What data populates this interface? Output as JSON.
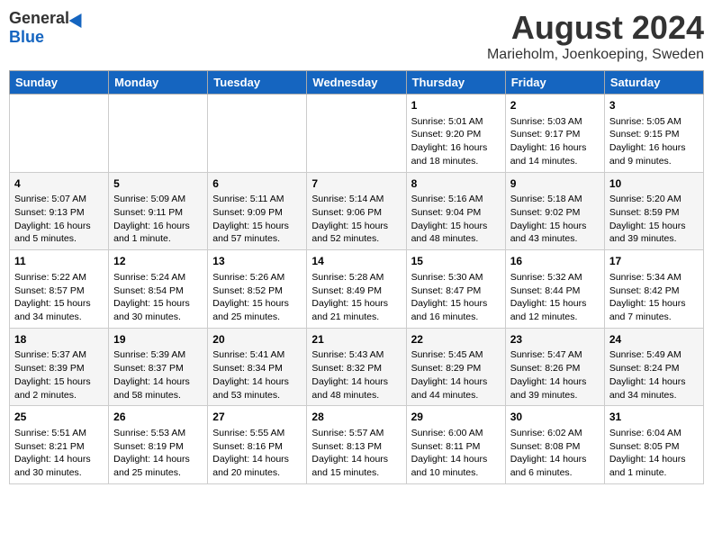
{
  "header": {
    "logo_general": "General",
    "logo_blue": "Blue",
    "month_year": "August 2024",
    "location": "Marieholm, Joenkoeping, Sweden"
  },
  "days_of_week": [
    "Sunday",
    "Monday",
    "Tuesday",
    "Wednesday",
    "Thursday",
    "Friday",
    "Saturday"
  ],
  "weeks": [
    [
      {
        "day": "",
        "info": ""
      },
      {
        "day": "",
        "info": ""
      },
      {
        "day": "",
        "info": ""
      },
      {
        "day": "",
        "info": ""
      },
      {
        "day": "1",
        "info": "Sunrise: 5:01 AM\nSunset: 9:20 PM\nDaylight: 16 hours\nand 18 minutes."
      },
      {
        "day": "2",
        "info": "Sunrise: 5:03 AM\nSunset: 9:17 PM\nDaylight: 16 hours\nand 14 minutes."
      },
      {
        "day": "3",
        "info": "Sunrise: 5:05 AM\nSunset: 9:15 PM\nDaylight: 16 hours\nand 9 minutes."
      }
    ],
    [
      {
        "day": "4",
        "info": "Sunrise: 5:07 AM\nSunset: 9:13 PM\nDaylight: 16 hours\nand 5 minutes."
      },
      {
        "day": "5",
        "info": "Sunrise: 5:09 AM\nSunset: 9:11 PM\nDaylight: 16 hours\nand 1 minute."
      },
      {
        "day": "6",
        "info": "Sunrise: 5:11 AM\nSunset: 9:09 PM\nDaylight: 15 hours\nand 57 minutes."
      },
      {
        "day": "7",
        "info": "Sunrise: 5:14 AM\nSunset: 9:06 PM\nDaylight: 15 hours\nand 52 minutes."
      },
      {
        "day": "8",
        "info": "Sunrise: 5:16 AM\nSunset: 9:04 PM\nDaylight: 15 hours\nand 48 minutes."
      },
      {
        "day": "9",
        "info": "Sunrise: 5:18 AM\nSunset: 9:02 PM\nDaylight: 15 hours\nand 43 minutes."
      },
      {
        "day": "10",
        "info": "Sunrise: 5:20 AM\nSunset: 8:59 PM\nDaylight: 15 hours\nand 39 minutes."
      }
    ],
    [
      {
        "day": "11",
        "info": "Sunrise: 5:22 AM\nSunset: 8:57 PM\nDaylight: 15 hours\nand 34 minutes."
      },
      {
        "day": "12",
        "info": "Sunrise: 5:24 AM\nSunset: 8:54 PM\nDaylight: 15 hours\nand 30 minutes."
      },
      {
        "day": "13",
        "info": "Sunrise: 5:26 AM\nSunset: 8:52 PM\nDaylight: 15 hours\nand 25 minutes."
      },
      {
        "day": "14",
        "info": "Sunrise: 5:28 AM\nSunset: 8:49 PM\nDaylight: 15 hours\nand 21 minutes."
      },
      {
        "day": "15",
        "info": "Sunrise: 5:30 AM\nSunset: 8:47 PM\nDaylight: 15 hours\nand 16 minutes."
      },
      {
        "day": "16",
        "info": "Sunrise: 5:32 AM\nSunset: 8:44 PM\nDaylight: 15 hours\nand 12 minutes."
      },
      {
        "day": "17",
        "info": "Sunrise: 5:34 AM\nSunset: 8:42 PM\nDaylight: 15 hours\nand 7 minutes."
      }
    ],
    [
      {
        "day": "18",
        "info": "Sunrise: 5:37 AM\nSunset: 8:39 PM\nDaylight: 15 hours\nand 2 minutes."
      },
      {
        "day": "19",
        "info": "Sunrise: 5:39 AM\nSunset: 8:37 PM\nDaylight: 14 hours\nand 58 minutes."
      },
      {
        "day": "20",
        "info": "Sunrise: 5:41 AM\nSunset: 8:34 PM\nDaylight: 14 hours\nand 53 minutes."
      },
      {
        "day": "21",
        "info": "Sunrise: 5:43 AM\nSunset: 8:32 PM\nDaylight: 14 hours\nand 48 minutes."
      },
      {
        "day": "22",
        "info": "Sunrise: 5:45 AM\nSunset: 8:29 PM\nDaylight: 14 hours\nand 44 minutes."
      },
      {
        "day": "23",
        "info": "Sunrise: 5:47 AM\nSunset: 8:26 PM\nDaylight: 14 hours\nand 39 minutes."
      },
      {
        "day": "24",
        "info": "Sunrise: 5:49 AM\nSunset: 8:24 PM\nDaylight: 14 hours\nand 34 minutes."
      }
    ],
    [
      {
        "day": "25",
        "info": "Sunrise: 5:51 AM\nSunset: 8:21 PM\nDaylight: 14 hours\nand 30 minutes."
      },
      {
        "day": "26",
        "info": "Sunrise: 5:53 AM\nSunset: 8:19 PM\nDaylight: 14 hours\nand 25 minutes."
      },
      {
        "day": "27",
        "info": "Sunrise: 5:55 AM\nSunset: 8:16 PM\nDaylight: 14 hours\nand 20 minutes."
      },
      {
        "day": "28",
        "info": "Sunrise: 5:57 AM\nSunset: 8:13 PM\nDaylight: 14 hours\nand 15 minutes."
      },
      {
        "day": "29",
        "info": "Sunrise: 6:00 AM\nSunset: 8:11 PM\nDaylight: 14 hours\nand 10 minutes."
      },
      {
        "day": "30",
        "info": "Sunrise: 6:02 AM\nSunset: 8:08 PM\nDaylight: 14 hours\nand 6 minutes."
      },
      {
        "day": "31",
        "info": "Sunrise: 6:04 AM\nSunset: 8:05 PM\nDaylight: 14 hours\nand 1 minute."
      }
    ]
  ]
}
